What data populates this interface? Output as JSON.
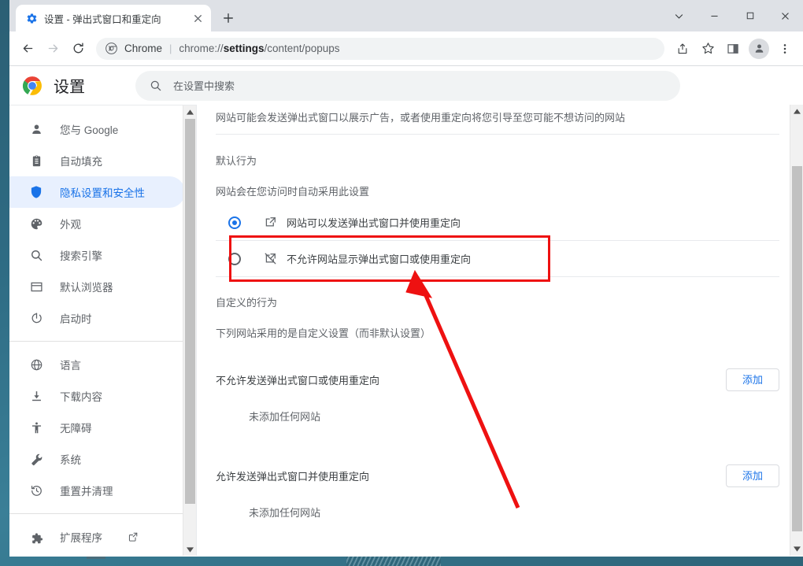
{
  "window": {
    "controls": {
      "tab_search_label": "tab-search",
      "minimize_label": "minimize",
      "maximize_label": "maximize",
      "close_label": "close"
    }
  },
  "tabstrip": {
    "tabs": [
      {
        "title": "设置 - 弹出式窗口和重定向",
        "favicon": "gear-icon",
        "close_label": "×"
      }
    ],
    "new_tab_label": "+"
  },
  "toolbar": {
    "back_label": "back",
    "forward_label": "forward",
    "reload_label": "reload",
    "omnibox": {
      "chrome_label": "Chrome",
      "separator": "|",
      "url_prefix": "chrome://",
      "url_bold": "settings",
      "url_suffix": "/content/popups"
    },
    "share_label": "share",
    "bookmark_label": "bookmark",
    "sidepanel_label": "side-panel",
    "profile_label": "profile",
    "menu_label": "more"
  },
  "settings": {
    "title": "设置",
    "search": {
      "placeholder": "在设置中搜索"
    }
  },
  "sidebar": {
    "items": [
      {
        "label": "您与 Google",
        "icon": "person-icon",
        "active": false
      },
      {
        "label": "自动填充",
        "icon": "clipboard-icon",
        "active": false
      },
      {
        "label": "隐私设置和安全性",
        "icon": "shield-icon",
        "active": true
      },
      {
        "label": "外观",
        "icon": "palette-icon",
        "active": false
      },
      {
        "label": "搜索引擎",
        "icon": "search-icon",
        "active": false
      },
      {
        "label": "默认浏览器",
        "icon": "browser-window-icon",
        "active": false
      },
      {
        "label": "启动时",
        "icon": "power-icon",
        "active": false
      }
    ],
    "items2": [
      {
        "label": "语言",
        "icon": "globe-icon",
        "active": false
      },
      {
        "label": "下载内容",
        "icon": "download-icon",
        "active": false
      },
      {
        "label": "无障碍",
        "icon": "accessibility-icon",
        "active": false
      },
      {
        "label": "系统",
        "icon": "wrench-icon",
        "active": false
      },
      {
        "label": "重置并清理",
        "icon": "history-restore-icon",
        "active": false
      }
    ],
    "items3": [
      {
        "label": "扩展程序",
        "icon": "puzzle-icon",
        "external": true,
        "active": false
      }
    ]
  },
  "main": {
    "description": "网站可能会发送弹出式窗口以展示广告，或者使用重定向将您引导至您可能不想访问的网站",
    "default_behavior_title": "默认行为",
    "default_behavior_desc": "网站会在您访问时自动采用此设置",
    "options": [
      {
        "label": "网站可以发送弹出式窗口并使用重定向",
        "icon": "open-in-new-icon",
        "selected": true
      },
      {
        "label": "不允许网站显示弹出式窗口或使用重定向",
        "icon": "open-in-new-off-icon",
        "selected": false
      }
    ],
    "custom_title": "自定义的行为",
    "custom_desc": "下列网站采用的是自定义设置（而非默认设置）",
    "permission_groups": [
      {
        "label": "不允许发送弹出式窗口或使用重定向",
        "button": "添加",
        "empty": "未添加任何网站"
      },
      {
        "label": "允许发送弹出式窗口并使用重定向",
        "button": "添加",
        "empty": "未添加任何网站"
      }
    ]
  },
  "annotations": {
    "highlight_color": "#ee1111",
    "arrow_color": "#ee1111",
    "arrow_from": "658,645",
    "arrow_to": "527,344"
  }
}
